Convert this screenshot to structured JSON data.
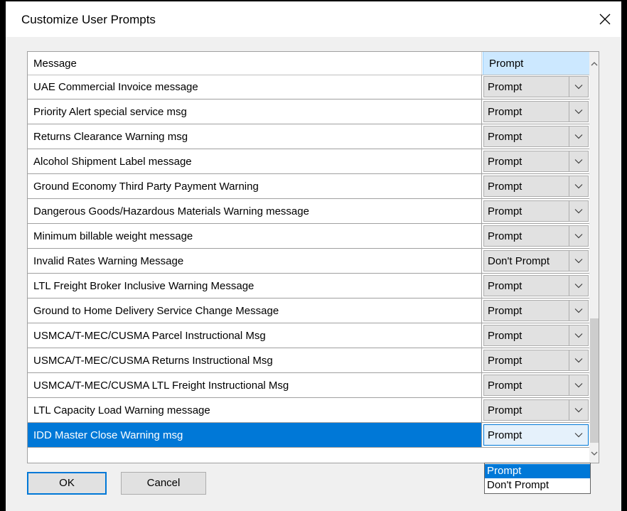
{
  "window": {
    "title": "Customize User Prompts"
  },
  "icons": {
    "close": "close-icon",
    "dropdown": "chevron-down-icon",
    "scroll_up": "chevron-up-icon",
    "scroll_down": "chevron-down-icon"
  },
  "colors": {
    "selection": "#0078d7",
    "header_highlight": "#cce8ff"
  },
  "grid": {
    "columns": {
      "message": "Message",
      "prompt": "Prompt"
    },
    "rows": [
      {
        "message": "UAE Commercial Invoice message",
        "prompt": "Prompt"
      },
      {
        "message": "Priority Alert special service msg",
        "prompt": "Prompt"
      },
      {
        "message": "Returns Clearance Warning msg",
        "prompt": "Prompt"
      },
      {
        "message": "Alcohol Shipment Label message",
        "prompt": "Prompt"
      },
      {
        "message": "Ground Economy Third Party Payment Warning",
        "prompt": "Prompt"
      },
      {
        "message": "Dangerous Goods/Hazardous Materials Warning message",
        "prompt": "Prompt"
      },
      {
        "message": "Minimum billable weight message",
        "prompt": "Prompt"
      },
      {
        "message": "Invalid Rates Warning Message",
        "prompt": "Don't Prompt"
      },
      {
        "message": "LTL Freight Broker Inclusive Warning Message",
        "prompt": "Prompt"
      },
      {
        "message": "Ground to Home Delivery Service Change Message",
        "prompt": "Prompt"
      },
      {
        "message": "USMCA/T-MEC/CUSMA Parcel Instructional Msg",
        "prompt": "Prompt"
      },
      {
        "message": "USMCA/T-MEC/CUSMA Returns Instructional Msg",
        "prompt": "Prompt"
      },
      {
        "message": "USMCA/T-MEC/CUSMA LTL Freight Instructional Msg",
        "prompt": "Prompt"
      },
      {
        "message": "LTL Capacity Load Warning message",
        "prompt": "Prompt"
      },
      {
        "message": "IDD Master Close Warning msg",
        "prompt": "Prompt",
        "selected": true
      }
    ]
  },
  "dropdown_options": [
    "Prompt",
    "Don't Prompt"
  ],
  "buttons": {
    "ok": "OK",
    "cancel": "Cancel"
  }
}
